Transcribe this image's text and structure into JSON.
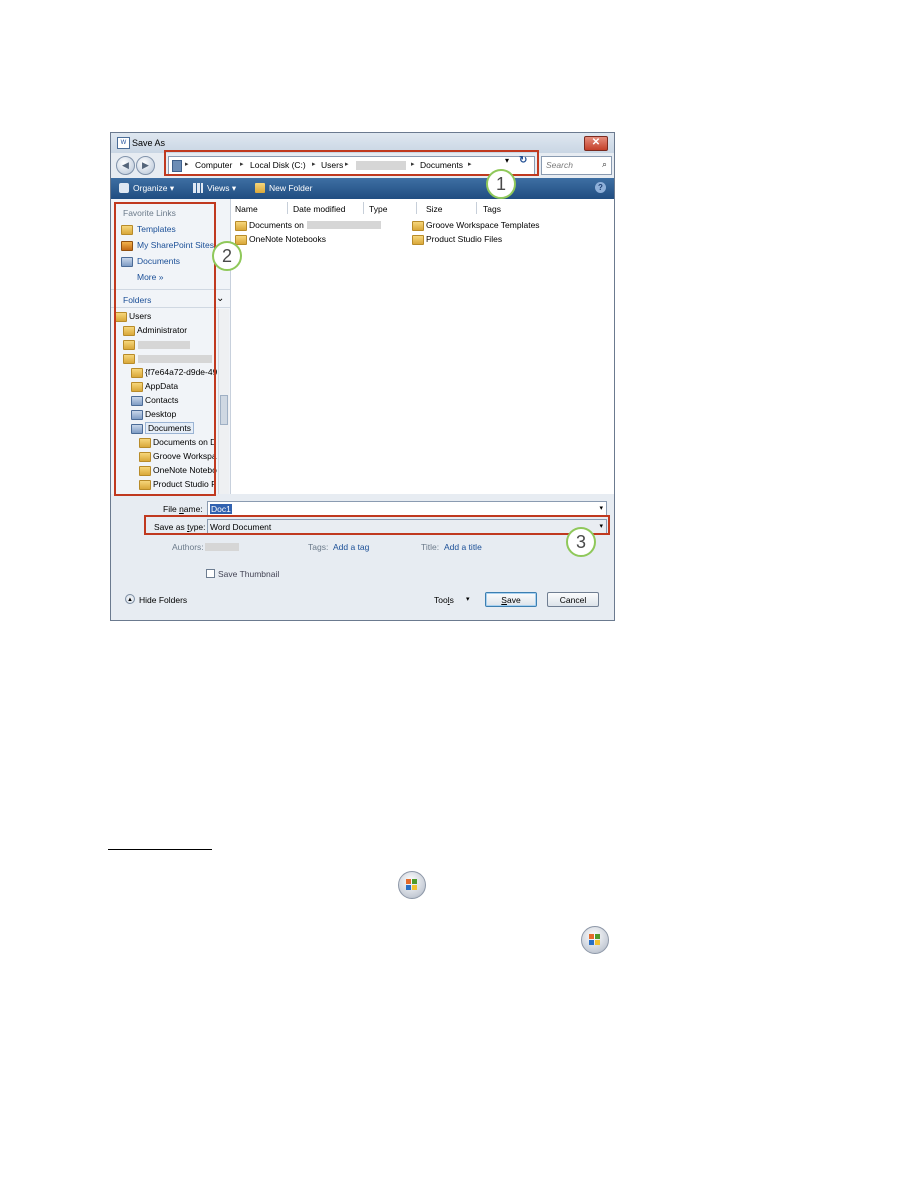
{
  "dialog": {
    "title": "Save As",
    "close_glyph": "✕",
    "back_glyph": "◀",
    "forward_glyph": "▶",
    "address": {
      "crumbs": [
        "Computer",
        "Local Disk (C:)",
        "Users",
        "Documents"
      ],
      "separator": "▸",
      "dropdown_glyph": "▾",
      "refresh_glyph": "↻"
    },
    "search_placeholder": "Search",
    "search_icon": "⌕",
    "toolbar": {
      "organize": "Organize ▾",
      "views": "Views ▾",
      "new_folder": "New Folder",
      "help": "?"
    },
    "favorite_links": {
      "header": "Favorite Links",
      "items": [
        "Templates",
        "My SharePoint Sites",
        "Documents"
      ],
      "more": "More »"
    },
    "folders": {
      "header": "Folders",
      "chevron": "⌄",
      "tree": [
        "Users",
        "Administrator",
        "{f7e64a72-d9de-49",
        "AppData",
        "Contacts",
        "Desktop",
        "Documents",
        "Documents on D",
        "Groove Workspa",
        "OneNote Notebo",
        "Product Studio F"
      ]
    },
    "columns": [
      "Name",
      "Date modified",
      "Type",
      "Size",
      "Tags"
    ],
    "files": {
      "left": [
        "Documents on",
        "OneNote Notebooks"
      ],
      "right": [
        "Groove Workspace Templates",
        "Product Studio Files"
      ]
    },
    "file_name": {
      "label_pre": "File ",
      "label_u": "n",
      "label_post": "ame:",
      "value": "Doc1"
    },
    "save_type": {
      "label_pre": "Save as ",
      "label_u": "t",
      "label_post": "ype:",
      "value": "Word Document"
    },
    "authors_label": "Authors:",
    "tags_label": "Tags:",
    "tags_value": "Add a tag",
    "title_label": "Title:",
    "title_value": "Add a title",
    "save_thumbnail": "Save Thumbnail",
    "hide_folders": "Hide Folders",
    "tools": {
      "pre": "Too",
      "u": "l",
      "post": "s",
      "arrow": "▾"
    },
    "save_button": {
      "u": "S",
      "post": "ave"
    },
    "cancel_button": "Cancel"
  },
  "callouts": [
    "1",
    "2",
    "3"
  ],
  "colors": {
    "callout_border": "#c0391f",
    "callout_ring": "#8fc85a",
    "toolbar": "#2f5d92"
  }
}
